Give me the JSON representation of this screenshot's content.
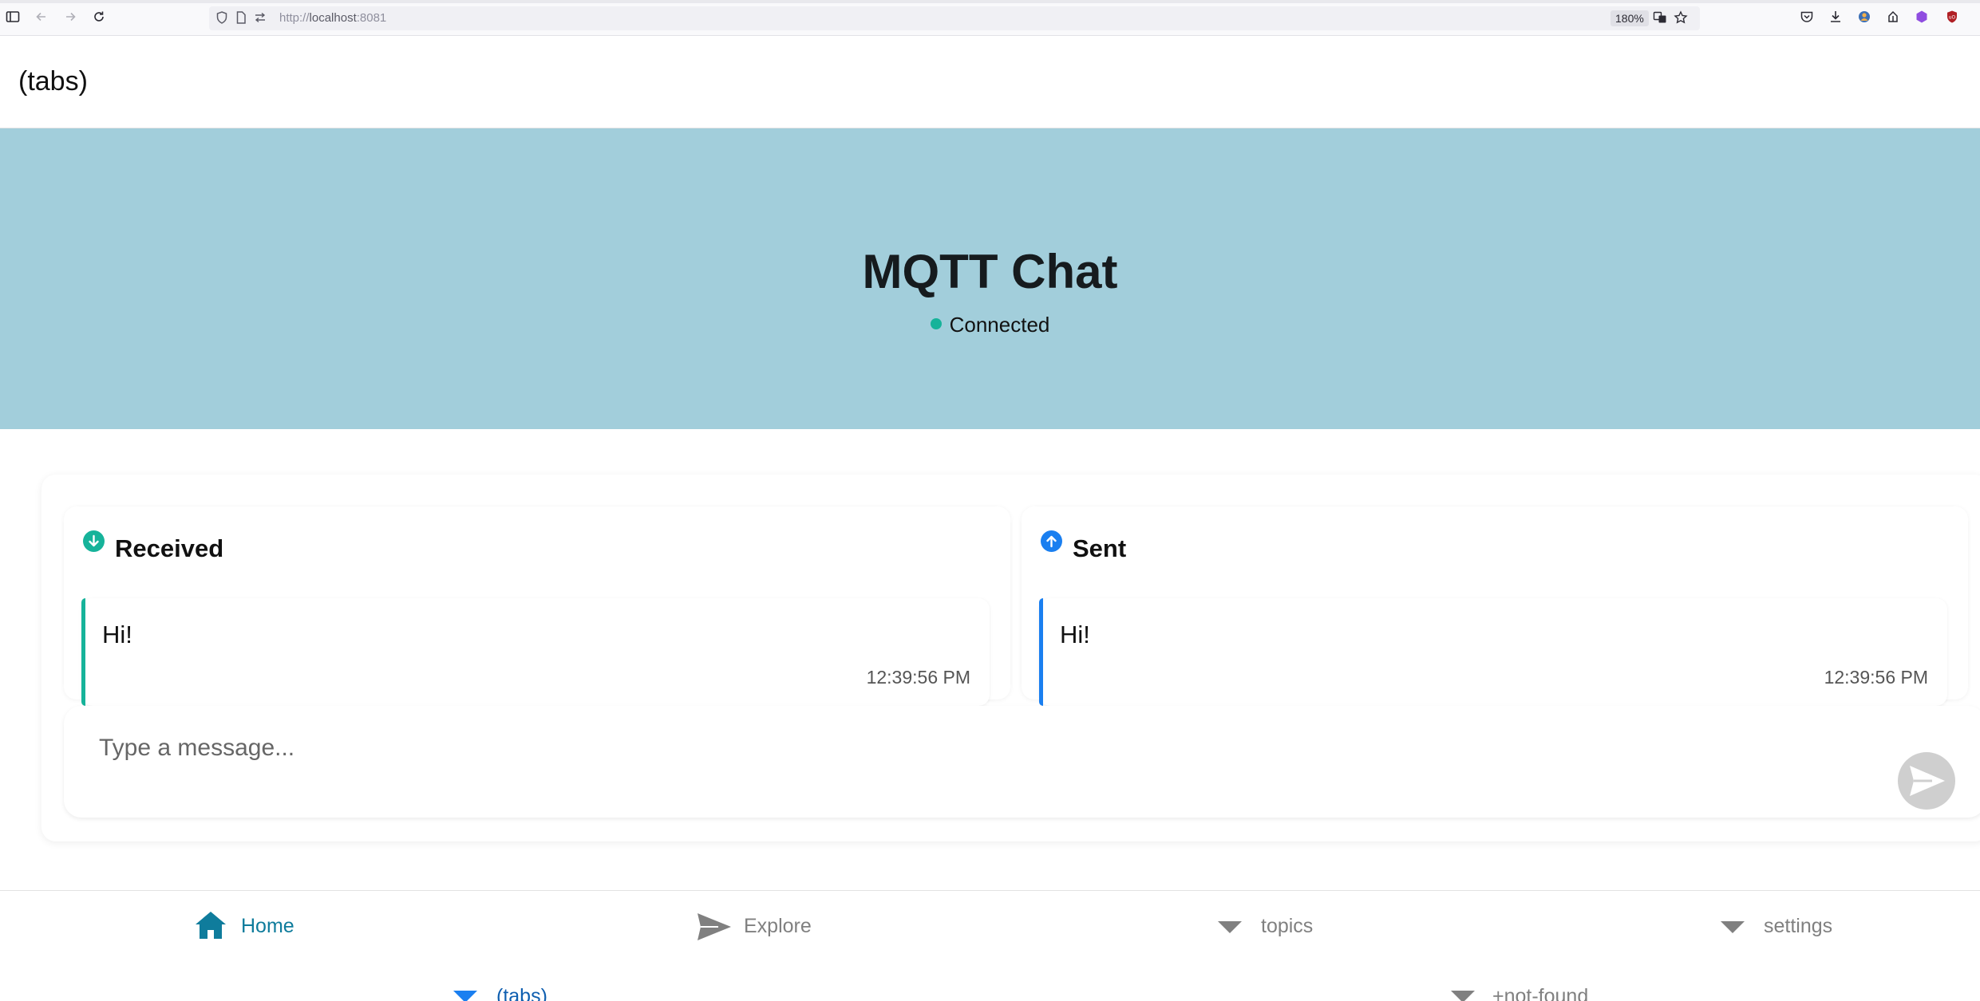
{
  "browser": {
    "url_scheme": "http://",
    "url_host": "localhost",
    "url_port": ":8081",
    "zoom": "180%"
  },
  "header": {
    "title": "(tabs)"
  },
  "hero": {
    "title": "MQTT Chat",
    "status": "Connected",
    "status_color": "#16b39a"
  },
  "received": {
    "title": "Received",
    "accent": "#16b39a",
    "icon": "arrow-down-circle-icon",
    "messages": [
      {
        "text": "Hi!",
        "time": "12:39:56 PM"
      }
    ]
  },
  "sent": {
    "title": "Sent",
    "accent": "#1a7ff0",
    "icon": "arrow-up-circle-icon",
    "messages": [
      {
        "text": "Hi!",
        "time": "12:39:56 PM"
      }
    ]
  },
  "composer": {
    "placeholder": "Type a message...",
    "send_icon": "send-icon"
  },
  "tabs": [
    {
      "label": "Home",
      "icon": "home-icon",
      "active": true
    },
    {
      "label": "Explore",
      "icon": "send-icon",
      "active": false
    },
    {
      "label": "topics",
      "icon": "triangle-down-icon",
      "active": false
    },
    {
      "label": "settings",
      "icon": "triangle-down-icon",
      "active": false
    }
  ],
  "subtabs": [
    {
      "label": "(tabs)",
      "icon": "triangle-down-icon",
      "active": true
    },
    {
      "label": "+not-found",
      "icon": "triangle-down-icon",
      "active": false
    }
  ],
  "colors": {
    "hero_bg": "#a2cedb",
    "active_tab": "#0f7c9c",
    "inactive_tab": "#808080"
  }
}
